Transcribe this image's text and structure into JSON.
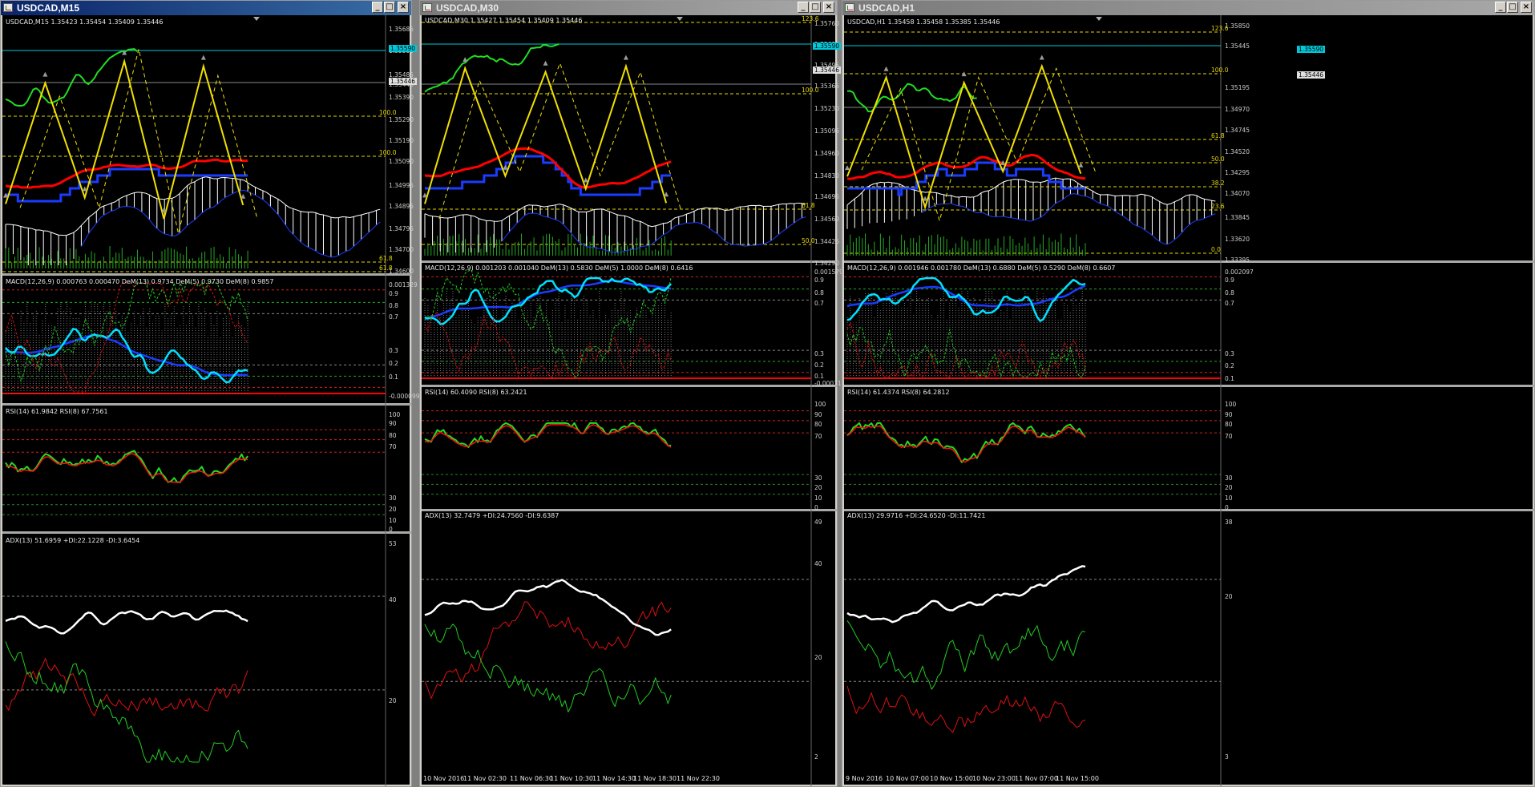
{
  "windows": [
    {
      "id": "m15",
      "title": "USDCAD,M15",
      "active": true,
      "main_header": "USDCAD,M15  1.35423  1.35454  1.35409  1.35446",
      "price_labels": [
        "1.35685",
        "1.35590",
        "1.35485",
        "1.35446",
        "1.35390",
        "1.35290",
        "1.35190",
        "1.35090",
        "1.34995",
        "1.34895",
        "1.34795",
        "1.34700",
        "1.34600"
      ],
      "price_tags": {
        "cyan": "1.35590",
        "gray": "1.35446"
      },
      "fib_levels": [
        "100.0",
        "100.0",
        "61.8",
        "61.8"
      ],
      "macd_header": "MACD(12,26,9) 0.000763 0.000470  DeM(13) 0.9734  DeM(5) 0.9730  DeM(8) 0.9857",
      "macd_labels": [
        "0.001329",
        "0.9",
        "0.8",
        "0.7",
        "0.3",
        "0.2",
        "0.1",
        "-0.000099"
      ],
      "rsi_header": "RSI(14) 61.9842  RSI(8) 67.7561",
      "rsi_labels": [
        "100",
        "90",
        "80",
        "70",
        "30",
        "20",
        "10",
        "0"
      ],
      "adx_header": "ADX(13) 51.6959 +DI:22.1228 -DI:3.6454",
      "adx_labels": [
        "53",
        "40",
        "20"
      ],
      "time_labels": []
    },
    {
      "id": "m30",
      "title": "USDCAD,M30",
      "active": false,
      "main_header": "USDCAD,M30  1.35427  1.35454  1.35409  1.35446",
      "price_labels": [
        "1.35760",
        "1.35630",
        "1.35495",
        "1.35365",
        "1.35230",
        "1.35095",
        "1.34960",
        "1.34830",
        "1.34695",
        "1.34560",
        "1.34425",
        "1.34290"
      ],
      "price_tags": {
        "cyan": "1.35590",
        "gray": "1.35446"
      },
      "fib_levels": [
        "123.6",
        "100.0",
        "61.8",
        "50.0"
      ],
      "macd_header": "MACD(12,26,9) 0.001203 0.001040  DeM(13) 0.5830  DeM(5) 1.0000  DeM(8) 0.6416",
      "macd_labels": [
        "0.001579",
        "0.9",
        "0.8",
        "0.7",
        "0.3",
        "0.2",
        "0.1",
        "-0.000118"
      ],
      "rsi_header": "RSI(14) 60.4090  RSI(8) 63.2421",
      "rsi_labels": [
        "100",
        "90",
        "80",
        "70",
        "30",
        "20",
        "10",
        "0"
      ],
      "adx_header": "ADX(13) 32.7479 +DI:24.7560 -DI:9.6387",
      "adx_labels": [
        "49",
        "40",
        "20",
        "2"
      ],
      "time_labels": [
        "10 Nov 2016",
        "11 Nov 02:30",
        "11 Nov 06:30",
        "11 Nov 10:30",
        "11 Nov 14:30",
        "11 Nov 18:30",
        "11 Nov 22:30"
      ]
    },
    {
      "id": "h1",
      "title": "USDCAD,H1",
      "active": false,
      "main_header": "USDCAD,H1  1.35458  1.35458  1.35385  1.35446",
      "price_labels": [
        "1.35850",
        "1.35445",
        "1.35195",
        "1.34970",
        "1.34745",
        "1.34520",
        "1.34295",
        "1.34070",
        "1.33845",
        "1.33620",
        "1.33395"
      ],
      "price_tags": {
        "cyan": "1.35590",
        "gray": "1.35446"
      },
      "fib_levels": [
        "123.6",
        "100.0",
        "61.8",
        "50.0",
        "38.2",
        "23.6",
        "0.0"
      ],
      "macd_header": "MACD(12,26,9) 0.001946 0.001780  DeM(13) 0.6880  DeM(5) 0.5290  DeM(8) 0.6607",
      "macd_labels": [
        "0.002097",
        "0.9",
        "0.8",
        "0.7",
        "0.3",
        "0.2",
        "0.1"
      ],
      "rsi_header": "RSI(14) 61.4374  RSI(8) 64.2812",
      "rsi_labels": [
        "100",
        "90",
        "80",
        "70",
        "30",
        "20",
        "10",
        "0"
      ],
      "adx_header": "ADX(13) 29.9716 +DI:24.6520 -DI:11.7421",
      "adx_labels": [
        "38",
        "20",
        "3"
      ],
      "time_labels": [
        "9 Nov 2016",
        "10 Nov 07:00",
        "10 Nov 15:00",
        "10 Nov 23:00",
        "11 Nov 07:00",
        "11 Nov 15:00"
      ]
    }
  ],
  "colors": {
    "tenkan": "#ff0000",
    "kijun": "#1a3cff",
    "zigzag": "#f0e000",
    "rsi_fast": "#22dd22",
    "rsi_slow": "#ff1010",
    "macd_main": "#00e0ff",
    "macd_signal": "#1a3cff",
    "adx_main": "#ffffff",
    "plus_di": "#22cc22",
    "minus_di": "#dd1010",
    "cloud": "#ffffff",
    "fib": "#e6d800",
    "volume": "#22aa22"
  }
}
